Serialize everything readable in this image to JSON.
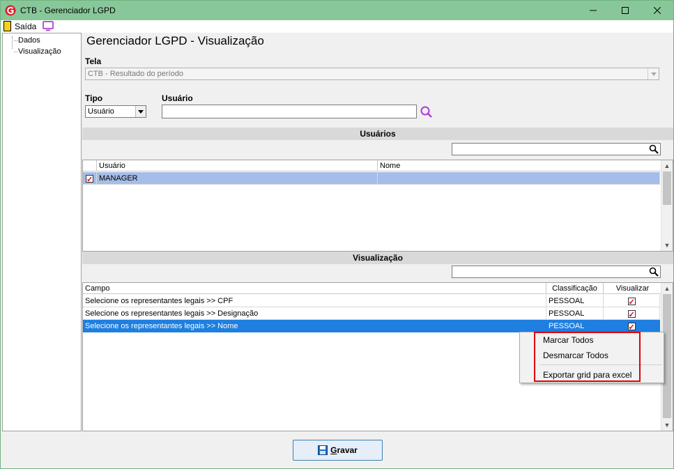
{
  "window": {
    "title": "CTB - Gerenciador LGPD",
    "brand_color": "#d81e2c",
    "titlebar_color": "#88c79a"
  },
  "menu": {
    "exit_label": "Saída"
  },
  "tree": {
    "items": [
      {
        "label": "Dados"
      },
      {
        "label": "Visualização"
      }
    ]
  },
  "main": {
    "page_title": "Gerenciador LGPD - Visualização",
    "tela_label": "Tela",
    "tela_value": "CTB - Resultado do período",
    "tipo_label": "Tipo",
    "tipo_value": "Usuário",
    "usuario_label": "Usuário",
    "usuario_value": ""
  },
  "users_section": {
    "header": "Usuários",
    "filter_value": "",
    "columns": [
      "Usuário",
      "Nome"
    ],
    "rows": [
      {
        "usuario": "MANAGER",
        "nome": "",
        "checked": true
      }
    ]
  },
  "visualization_section": {
    "header": "Visualização",
    "filter_value": "",
    "columns": [
      "Campo",
      "Classificação",
      "Visualizar"
    ],
    "rows": [
      {
        "campo": "Selecione os representantes legais >> CPF",
        "classificacao": "PESSOAL",
        "visualizar": true
      },
      {
        "campo": "Selecione os representantes legais >> Designação",
        "classificacao": "PESSOAL",
        "visualizar": true
      },
      {
        "campo": "Selecione os representantes legais >> Nome",
        "classificacao": "PESSOAL",
        "visualizar": true
      }
    ],
    "selected_row": 2
  },
  "context_menu": {
    "items": [
      "Marcar Todos",
      "Desmarcar Todos",
      "Exportar grid para excel"
    ],
    "highlight_color": "#e00000"
  },
  "footer": {
    "save_prefix": "G",
    "save_rest": "ravar"
  }
}
